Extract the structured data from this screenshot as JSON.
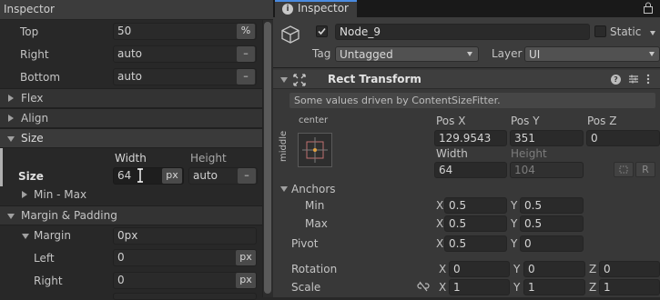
{
  "left": {
    "title": "Inspector",
    "top": {
      "label": "Top",
      "value": "50",
      "unit": "%"
    },
    "right": {
      "label": "Right",
      "value": "auto",
      "unit": "–"
    },
    "bottom": {
      "label": "Bottom",
      "value": "auto",
      "unit": "–"
    },
    "sections": {
      "flex": "Flex",
      "align": "Align",
      "size": "Size",
      "margin_padding": "Margin & Padding"
    },
    "size": {
      "width_header": "Width",
      "height_header": "Height",
      "row_label": "Size",
      "width_value": "64",
      "width_unit": "px",
      "height_value": "auto",
      "height_unit": "–",
      "min_max": "Min - Max"
    },
    "margin": {
      "label": "Margin",
      "value": "0px",
      "left_label": "Left",
      "left_value": "0",
      "left_unit": "px",
      "right_label": "Right",
      "right_value": "0",
      "right_unit": "px"
    }
  },
  "right": {
    "tab_title": "Inspector",
    "node_name": "Node_9",
    "static_label": "Static",
    "tag_label": "Tag",
    "tag_value": "Untagged",
    "layer_label": "Layer",
    "layer_value": "UI",
    "component_title": "Rect Transform",
    "driven_note": "Some values driven by ContentSizeFitter.",
    "anchor_preset": {
      "horizontal": "center",
      "vertical": "middle"
    },
    "pos": {
      "x_label": "Pos X",
      "y_label": "Pos Y",
      "z_label": "Pos Z",
      "x": "129.9543",
      "y": "351",
      "z": "0"
    },
    "dims": {
      "width_label": "Width",
      "height_label": "Height",
      "width": "64",
      "height": "104"
    },
    "r_button": "R",
    "anchors": {
      "label": "Anchors",
      "min_label": "Min",
      "max_label": "Max",
      "min_x": "0.5",
      "min_y": "0.5",
      "max_x": "0.5",
      "max_y": "0.5"
    },
    "pivot": {
      "label": "Pivot",
      "x": "0.5",
      "y": "0"
    },
    "rotation": {
      "label": "Rotation",
      "x": "0",
      "y": "0",
      "z": "0"
    },
    "scale": {
      "label": "Scale",
      "x": "1",
      "y": "1",
      "z": "1"
    },
    "axis": {
      "x": "X",
      "y": "Y",
      "z": "Z"
    }
  },
  "colors": {
    "accent_check": "#d6d6d6",
    "anchor_dot": "#e0a040",
    "anchor_frame": "#c07070"
  }
}
